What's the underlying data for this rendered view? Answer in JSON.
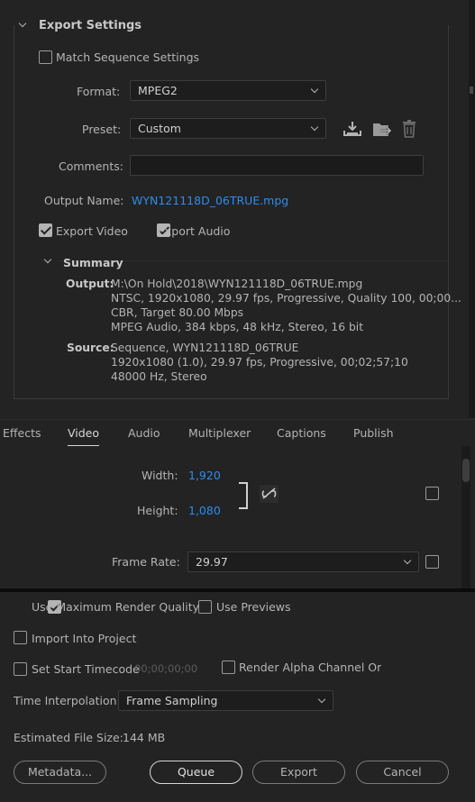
{
  "export_settings": {
    "header": "Export Settings",
    "match_sequence_label": "Match Sequence Settings",
    "match_sequence_checked": false,
    "format_label": "Format:",
    "format_value": "MPEG2",
    "preset_label": "Preset:",
    "preset_value": "Custom",
    "comments_label": "Comments:",
    "comments_value": "",
    "output_name_label": "Output Name:",
    "output_name_value": "WYN121118D_06TRUE.mpg",
    "export_video_label": "Export Video",
    "export_video_checked": true,
    "export_audio_label": "Export Audio",
    "export_audio_checked": true
  },
  "summary": {
    "header": "Summary",
    "output_key": "Output:",
    "output_lines": [
      "M:\\On Hold\\2018\\WYN121118D_06TRUE.mpg",
      "NTSC, 1920x1080, 29.97 fps, Progressive, Quality 100, 00;00...",
      "CBR, Target 80.00 Mbps",
      "MPEG Audio, 384 kbps, 48 kHz, Stereo, 16 bit"
    ],
    "source_key": "Source:",
    "source_lines": [
      "Sequence, WYN121118D_06TRUE",
      "1920x1080 (1.0), 29.97 fps, Progressive, 00;02;57;10",
      "48000 Hz, Stereo"
    ]
  },
  "tabs": [
    {
      "label": "Effects",
      "active": false
    },
    {
      "label": "Video",
      "active": true
    },
    {
      "label": "Audio",
      "active": false
    },
    {
      "label": "Multiplexer",
      "active": false
    },
    {
      "label": "Captions",
      "active": false
    },
    {
      "label": "Publish",
      "active": false
    }
  ],
  "video": {
    "width_label": "Width:",
    "width_value": "1,920",
    "height_label": "Height:",
    "height_value": "1,080",
    "frame_rate_label": "Frame Rate:",
    "frame_rate_value": "29.97"
  },
  "bottom": {
    "max_render_label": "Use Maximum Render Quality",
    "max_render_checked": true,
    "use_previews_label": "Use Previews",
    "use_previews_checked": false,
    "import_label": "Import Into Project",
    "import_checked": false,
    "start_tc_label": "Set Start Timecode",
    "start_tc_checked": false,
    "start_tc_value": "00;00;00;00",
    "render_alpha_label": "Render Alpha Channel Only",
    "render_alpha_checked": false,
    "time_interp_label": "Time Interpolation:",
    "time_interp_value": "Frame Sampling",
    "est_size_label": "Estimated File Size:",
    "est_size_value": "144 MB",
    "metadata_button": "Metadata...",
    "queue_button": "Queue",
    "export_button": "Export",
    "cancel_button": "Cancel"
  },
  "colors": {
    "background": "#232323",
    "link_blue": "#2d8ceb",
    "text": "#b4b4b4"
  }
}
